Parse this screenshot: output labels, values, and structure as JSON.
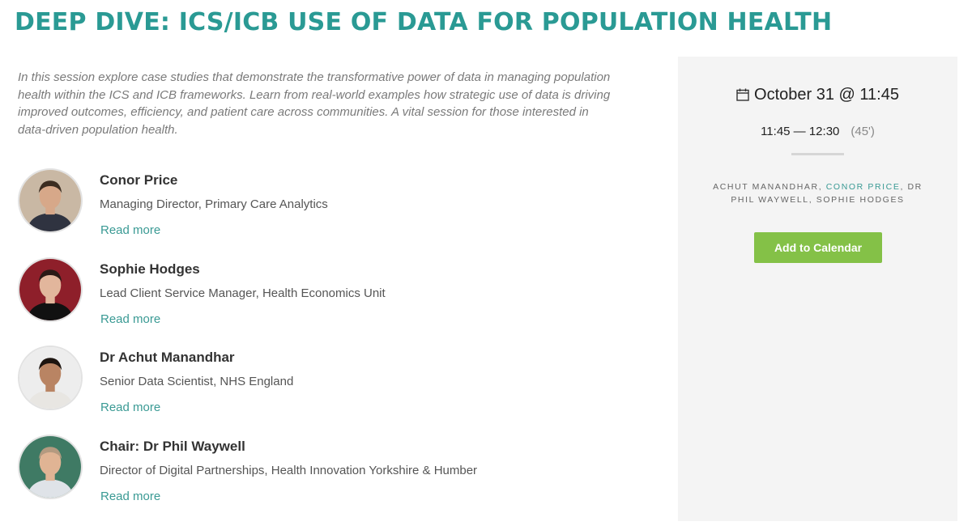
{
  "header": {
    "title": "DEEP DIVE: ICS/ICB USE OF DATA FOR POPULATION HEALTH"
  },
  "intro": "In this session explore case studies that demonstrate the transformative power of data in managing population health within the ICS and ICB frameworks. Learn from real-world examples how strategic use of data is driving improved outcomes, efficiency, and patient care across communities. A vital session for those interested in data-driven population health.",
  "speakers": [
    {
      "name": "Conor Price",
      "role": "Managing Director, Primary Care Analytics",
      "link": "Read more",
      "avatar_bg": "#c9b8a4",
      "skin": "#d7a889",
      "hair": "#3b2c20",
      "shirt": "#2f3340"
    },
    {
      "name": "Sophie Hodges",
      "role": "Lead Client Service Manager, Health Economics Unit",
      "link": "Read more",
      "avatar_bg": "#8e1f2a",
      "skin": "#e2b69c",
      "hair": "#2a1a16",
      "shirt": "#111111"
    },
    {
      "name": "Dr Achut Manandhar",
      "role": "Senior Data Scientist, NHS England",
      "link": "Read more",
      "avatar_bg": "#ededed",
      "skin": "#b98463",
      "hair": "#1d1510",
      "shirt": "#e8e6e2"
    },
    {
      "name": "Chair: Dr Phil Waywell",
      "role": "Director of Digital Partnerships, Health Innovation Yorkshire & Humber",
      "link": "Read more",
      "avatar_bg": "#3f7a64",
      "skin": "#e0b494",
      "hair": "#b49a80",
      "shirt": "#dfe3e8"
    }
  ],
  "sidebar": {
    "date": "October 31 @ 11:45",
    "time": "11:45 — 12:30",
    "duration": "(45')",
    "people_before": "Achut Manandhar, ",
    "people_link": "Conor Price",
    "people_after": ", Dr Phil Waywell, Sophie Hodges",
    "button": "Add to Calendar"
  },
  "colors": {
    "title": "#2a9a94",
    "link": "#3a9a94",
    "button": "#84c147",
    "sidebar_bg": "#f4f4f4"
  }
}
